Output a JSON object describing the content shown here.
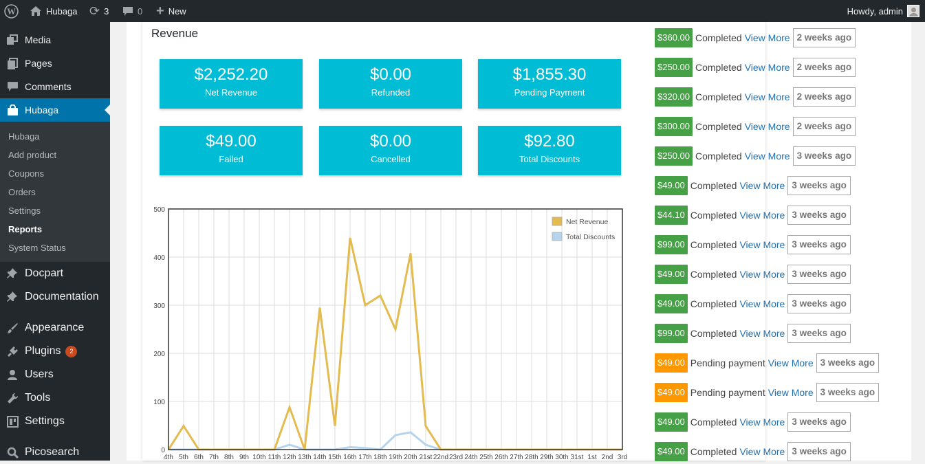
{
  "adminbar": {
    "site_name": "Hubaga",
    "updates_count": "3",
    "comments_count": "0",
    "new_label": "New",
    "howdy": "Howdy, admin"
  },
  "sidebar": {
    "menu": [
      {
        "label": "Media",
        "icon": "media-icon"
      },
      {
        "label": "Pages",
        "icon": "pages-icon"
      },
      {
        "label": "Comments",
        "icon": "comments-icon"
      },
      {
        "label": "Hubaga",
        "icon": "hubaga-bag-icon"
      },
      {
        "label": "Docpart",
        "icon": "pin-icon"
      },
      {
        "label": "Documentation",
        "icon": "pin-icon"
      },
      {
        "label": "Appearance",
        "icon": "brush-icon"
      },
      {
        "label": "Plugins",
        "icon": "plugin-icon",
        "badge": "2"
      },
      {
        "label": "Users",
        "icon": "users-icon"
      },
      {
        "label": "Tools",
        "icon": "wrench-icon"
      },
      {
        "label": "Settings",
        "icon": "settings-icon"
      },
      {
        "label": "Picosearch",
        "icon": "search-icon"
      }
    ],
    "submenu": [
      "Hubaga",
      "Add product",
      "Coupons",
      "Orders",
      "Settings",
      "Reports",
      "System Status"
    ]
  },
  "report": {
    "title": "Revenue",
    "stats": [
      {
        "value": "$2,252.20",
        "label": "Net Revenue"
      },
      {
        "value": "$0.00",
        "label": "Refunded"
      },
      {
        "value": "$1,855.30",
        "label": "Pending Payment"
      },
      {
        "value": "$49.00",
        "label": "Failed"
      },
      {
        "value": "$0.00",
        "label": "Cancelled"
      },
      {
        "value": "$92.80",
        "label": "Total Discounts"
      }
    ]
  },
  "chart_data": {
    "type": "line",
    "ylim": [
      0,
      500
    ],
    "yticks": [
      "0",
      "100",
      "200",
      "300",
      "400",
      "500"
    ],
    "categories": [
      "4th",
      "5th",
      "6th",
      "7th",
      "8th",
      "9th",
      "10th",
      "11th",
      "12th",
      "13th",
      "14th",
      "15th",
      "16th",
      "17th",
      "18th",
      "19th",
      "20th",
      "21st",
      "22nd",
      "23rd",
      "24th",
      "25th",
      "26th",
      "27th",
      "28th",
      "29th",
      "30th",
      "31st",
      "1st",
      "2nd",
      "3rd"
    ],
    "series": [
      {
        "name": "Net Revenue",
        "color": "#e3bb4f",
        "values": [
          0,
          49,
          0,
          0,
          0,
          0,
          0,
          0,
          88,
          0,
          295,
          49,
          440,
          300,
          320,
          250,
          408,
          49,
          0,
          0,
          0,
          0,
          0,
          0,
          0,
          0,
          0,
          0,
          0,
          0,
          0
        ]
      },
      {
        "name": "Total Discounts",
        "color": "#b5d4ec",
        "values": [
          0,
          0,
          0,
          0,
          0,
          0,
          0,
          0,
          10,
          0,
          0,
          0,
          5,
          3,
          0,
          30,
          36,
          10,
          0,
          0,
          0,
          0,
          0,
          0,
          0,
          0,
          0,
          0,
          0,
          0,
          0
        ]
      }
    ],
    "legend": "top-right",
    "grid": true
  },
  "orders": [
    {
      "amount": "$360.00",
      "status": "Completed",
      "link": "View More",
      "ago": "2 weeks ago",
      "color": "#46a046"
    },
    {
      "amount": "$250.00",
      "status": "Completed",
      "link": "View More",
      "ago": "2 weeks ago",
      "color": "#46a046"
    },
    {
      "amount": "$320.00",
      "status": "Completed",
      "link": "View More",
      "ago": "2 weeks ago",
      "color": "#46a046"
    },
    {
      "amount": "$300.00",
      "status": "Completed",
      "link": "View More",
      "ago": "2 weeks ago",
      "color": "#46a046"
    },
    {
      "amount": "$250.00",
      "status": "Completed",
      "link": "View More",
      "ago": "3 weeks ago",
      "color": "#46a046"
    },
    {
      "amount": "$49.00",
      "status": "Completed",
      "link": "View More",
      "ago": "3 weeks ago",
      "color": "#46a046"
    },
    {
      "amount": "$44.10",
      "status": "Completed",
      "link": "View More",
      "ago": "3 weeks ago",
      "color": "#46a046"
    },
    {
      "amount": "$99.00",
      "status": "Completed",
      "link": "View More",
      "ago": "3 weeks ago",
      "color": "#46a046"
    },
    {
      "amount": "$49.00",
      "status": "Completed",
      "link": "View More",
      "ago": "3 weeks ago",
      "color": "#46a046"
    },
    {
      "amount": "$49.00",
      "status": "Completed",
      "link": "View More",
      "ago": "3 weeks ago",
      "color": "#46a046"
    },
    {
      "amount": "$99.00",
      "status": "Completed",
      "link": "View More",
      "ago": "3 weeks ago",
      "color": "#46a046"
    },
    {
      "amount": "$49.00",
      "status": "Pending payment",
      "link": "View More",
      "ago": "3 weeks ago",
      "color": "#ff9800"
    },
    {
      "amount": "$49.00",
      "status": "Pending payment",
      "link": "View More",
      "ago": "3 weeks ago",
      "color": "#ff9800"
    },
    {
      "amount": "$49.00",
      "status": "Completed",
      "link": "View More",
      "ago": "3 weeks ago",
      "color": "#46a046"
    },
    {
      "amount": "$49.00",
      "status": "Completed",
      "link": "View More",
      "ago": "3 weeks ago",
      "color": "#46a046"
    }
  ]
}
